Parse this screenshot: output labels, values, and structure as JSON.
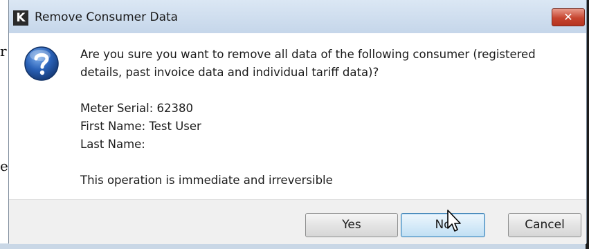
{
  "background": {
    "left_chars": [
      "r",
      "e"
    ]
  },
  "dialog": {
    "app_icon_letter": "K",
    "title": "Remove Consumer Data",
    "close_label": "✕",
    "question_icon": "question-mark-icon",
    "question_text": "Are you sure you want to remove all data of the following consumer (registered details, past invoice data and individual tariff data)?",
    "details": [
      "Meter Serial: 62380",
      "First Name: Test User",
      "Last Name:"
    ],
    "warning_text": "This operation is immediate and irreversible",
    "buttons": {
      "yes": "Yes",
      "no": "No",
      "cancel": "Cancel"
    }
  },
  "colors": {
    "titlebar": "#c5d6ea",
    "close_button": "#c6442e",
    "default_button_border": "#3c7fb1",
    "question_icon": "#2a62b8"
  }
}
